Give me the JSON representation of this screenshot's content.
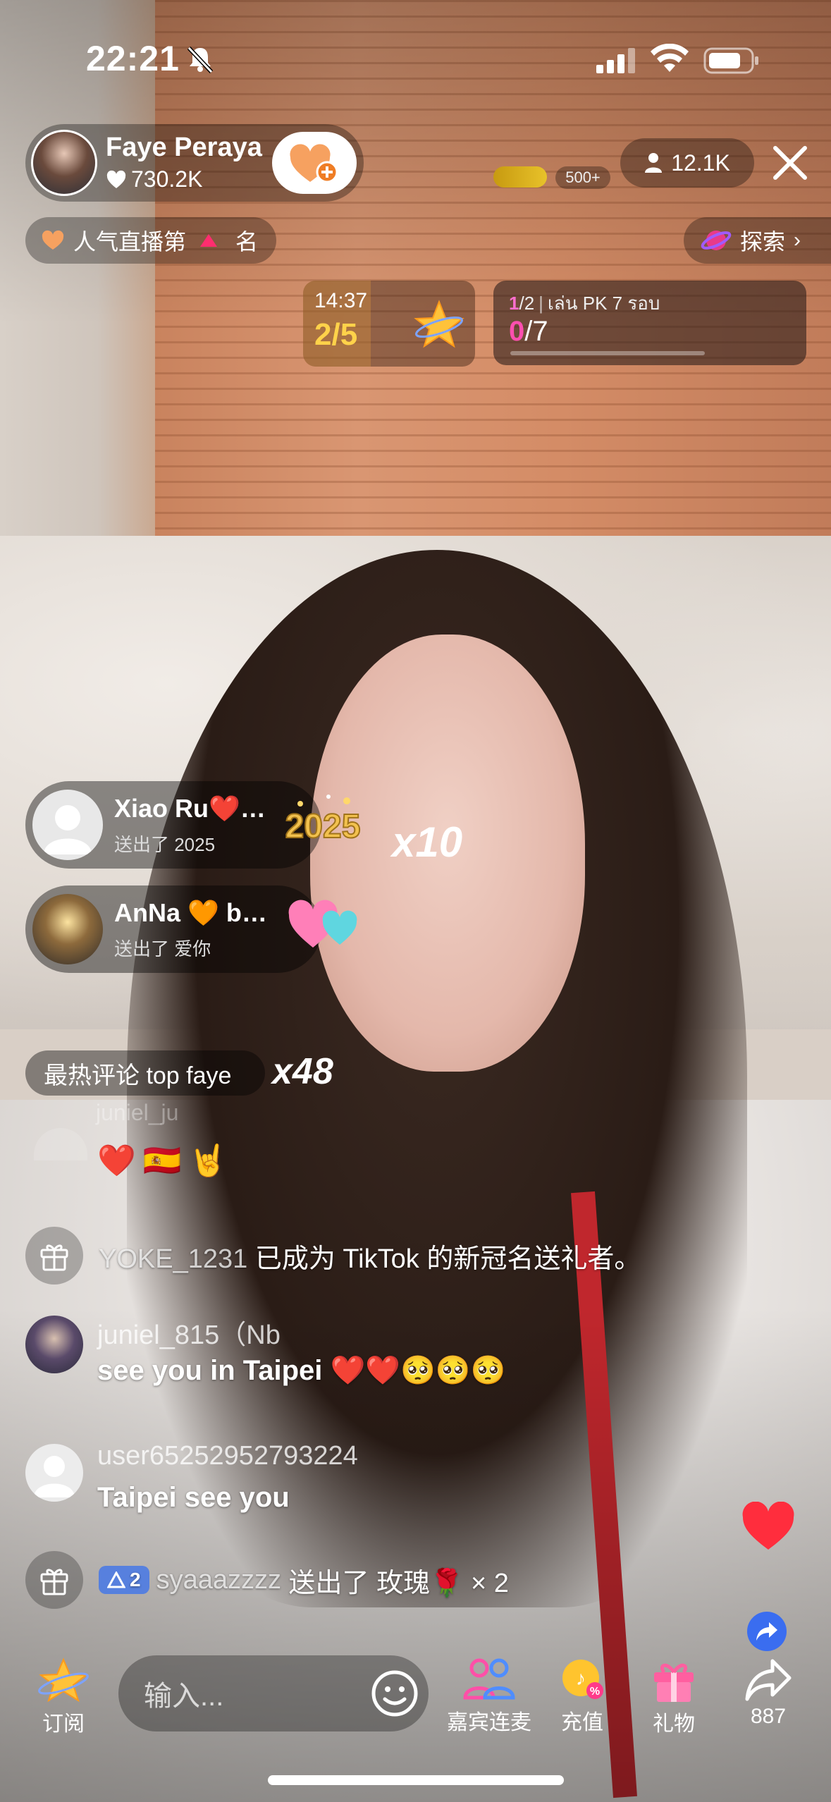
{
  "status_bar": {
    "time": "22:21"
  },
  "host": {
    "name": "Faye Peraya",
    "likes": "730.2K",
    "viewers": "12.1K",
    "gift_rank": "500+"
  },
  "rank_pill": {
    "prefix": "人气直播第",
    "suffix": "名"
  },
  "explore": {
    "label": "探索"
  },
  "timer_card": {
    "time": "14:37",
    "progress": "2/5"
  },
  "pk_card": {
    "round": "1",
    "round_total": "/2",
    "title": "เล่น PK 7 รอบ",
    "score": "0",
    "score_total": "/7",
    "progress_fraction": 0
  },
  "gifts": [
    {
      "user": "Xiao Ru❤️…",
      "desc": "送出了 2025",
      "multiplier": "x10",
      "gift_icon": "2025-gift-icon"
    },
    {
      "user": "AnNa 🧡 b…",
      "desc": "送出了 爱你",
      "multiplier": "",
      "gift_icon": "love-hearts-gift-icon"
    }
  ],
  "hot_comment": {
    "label": "最热评论 top faye",
    "multiplier": "x48"
  },
  "ghost_comment": {
    "user": "juniel_ju",
    "emojis": [
      "❤️",
      "🇪🇸",
      "🤘"
    ]
  },
  "system_messages": [
    {
      "icon": "gift-icon",
      "user": "YOKE_1231",
      "text": " 已成为 TikTok 的新冠名送礼者。"
    }
  ],
  "comments": [
    {
      "user": "juniel_815（Nb",
      "text": "see you in Taipei ❤️❤️🥺🥺🥺"
    },
    {
      "user": "user65252952793224",
      "text": "Taipei see you"
    }
  ],
  "gift_message": {
    "level": "2",
    "user": "syaaazzzz",
    "text": " 送出了 玫瑰🌹 × 2"
  },
  "toolbar": {
    "subscribe": "订阅",
    "input_placeholder": "输入...",
    "guest": "嘉宾连麦",
    "recharge": "充值",
    "gift": "礼物",
    "share_count": "887"
  },
  "colors": {
    "accent_pink": "#ff4fb0",
    "gold": "#ffd24a",
    "heart_red": "#ff2d3d"
  }
}
